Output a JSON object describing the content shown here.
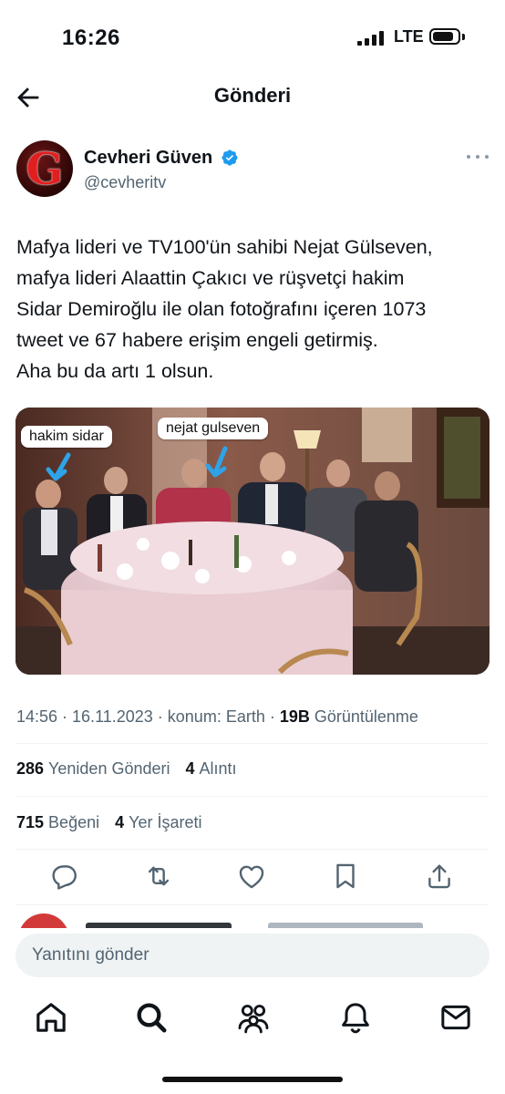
{
  "status_bar": {
    "time": "16:26",
    "network": "LTE"
  },
  "header": {
    "title": "Gönderi"
  },
  "author": {
    "name": "Cevheri Güven",
    "handle": "@cevheritv",
    "avatar_letter": "G"
  },
  "tweet": {
    "text_lines": [
      "Mafya lideri ve TV100'ün sahibi Nejat Gülseven,",
      "mafya lideri Alaattin Çakıcı ve rüşvetçi hakim",
      "Sidar Demiroğlu ile olan fotoğrafını içeren 1073",
      "tweet ve 67 habere erişim engeli getirmiş.",
      "Aha bu da artı 1 olsun."
    ],
    "image_labels": {
      "left": "hakim sidar",
      "right": "nejat gulseven"
    }
  },
  "meta": {
    "timestamp": "14:56 · 16.11.2023 · konum: Earth · ",
    "views_count": "19B",
    "views_label": " Görüntülenme"
  },
  "stats": {
    "reposts_count": "286",
    "reposts_label": "Yeniden Gönderi",
    "quotes_count": "4",
    "quotes_label": "Alıntı",
    "likes_count": "715",
    "likes_label": "Beğeni",
    "bookmarks_count": "4",
    "bookmarks_label": "Yer İşareti"
  },
  "reply": {
    "placeholder": "Yanıtını gönder"
  },
  "icons": {
    "actions": [
      "reply-icon",
      "repost-icon",
      "like-icon",
      "bookmark-icon",
      "share-icon"
    ],
    "tabs": [
      "home-icon",
      "search-icon",
      "communities-icon",
      "notifications-icon",
      "messages-icon"
    ]
  },
  "colors": {
    "verified_blue": "#1d9bf0",
    "secondary_text": "#536471",
    "accent_red": "#e11f1f"
  }
}
